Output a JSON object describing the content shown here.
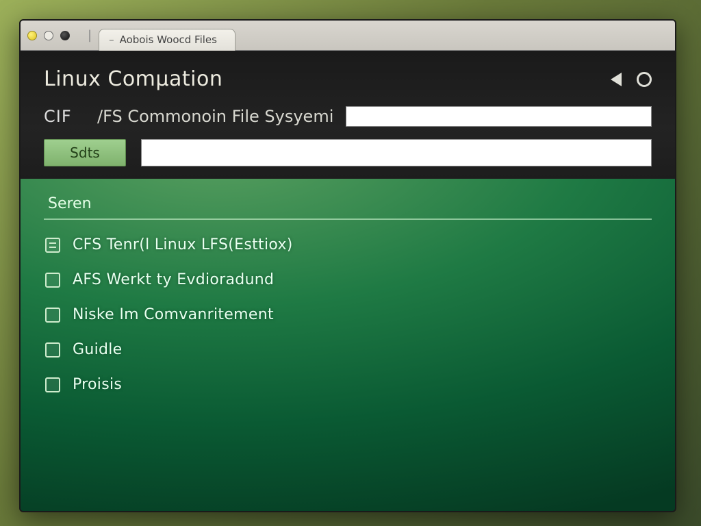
{
  "tab": {
    "label": "Aobois Woocd Files"
  },
  "header": {
    "title": "Linux Comµation",
    "abbr": "CIF",
    "subtitle": "/FS Commonoin File Sysyemi",
    "button_label": "Sdts"
  },
  "list": {
    "column_header": "Seren",
    "items": [
      {
        "icon": "doc",
        "label": "CFS Tenr(l Linux LFS(Esttiox)"
      },
      {
        "icon": "chk",
        "label": "AFS Werkt ty Evdioradund"
      },
      {
        "icon": "chk",
        "label": "Niske Im Comvanritement"
      },
      {
        "icon": "chk",
        "label": "Guidle"
      },
      {
        "icon": "chk",
        "label": "Proisis"
      }
    ]
  }
}
